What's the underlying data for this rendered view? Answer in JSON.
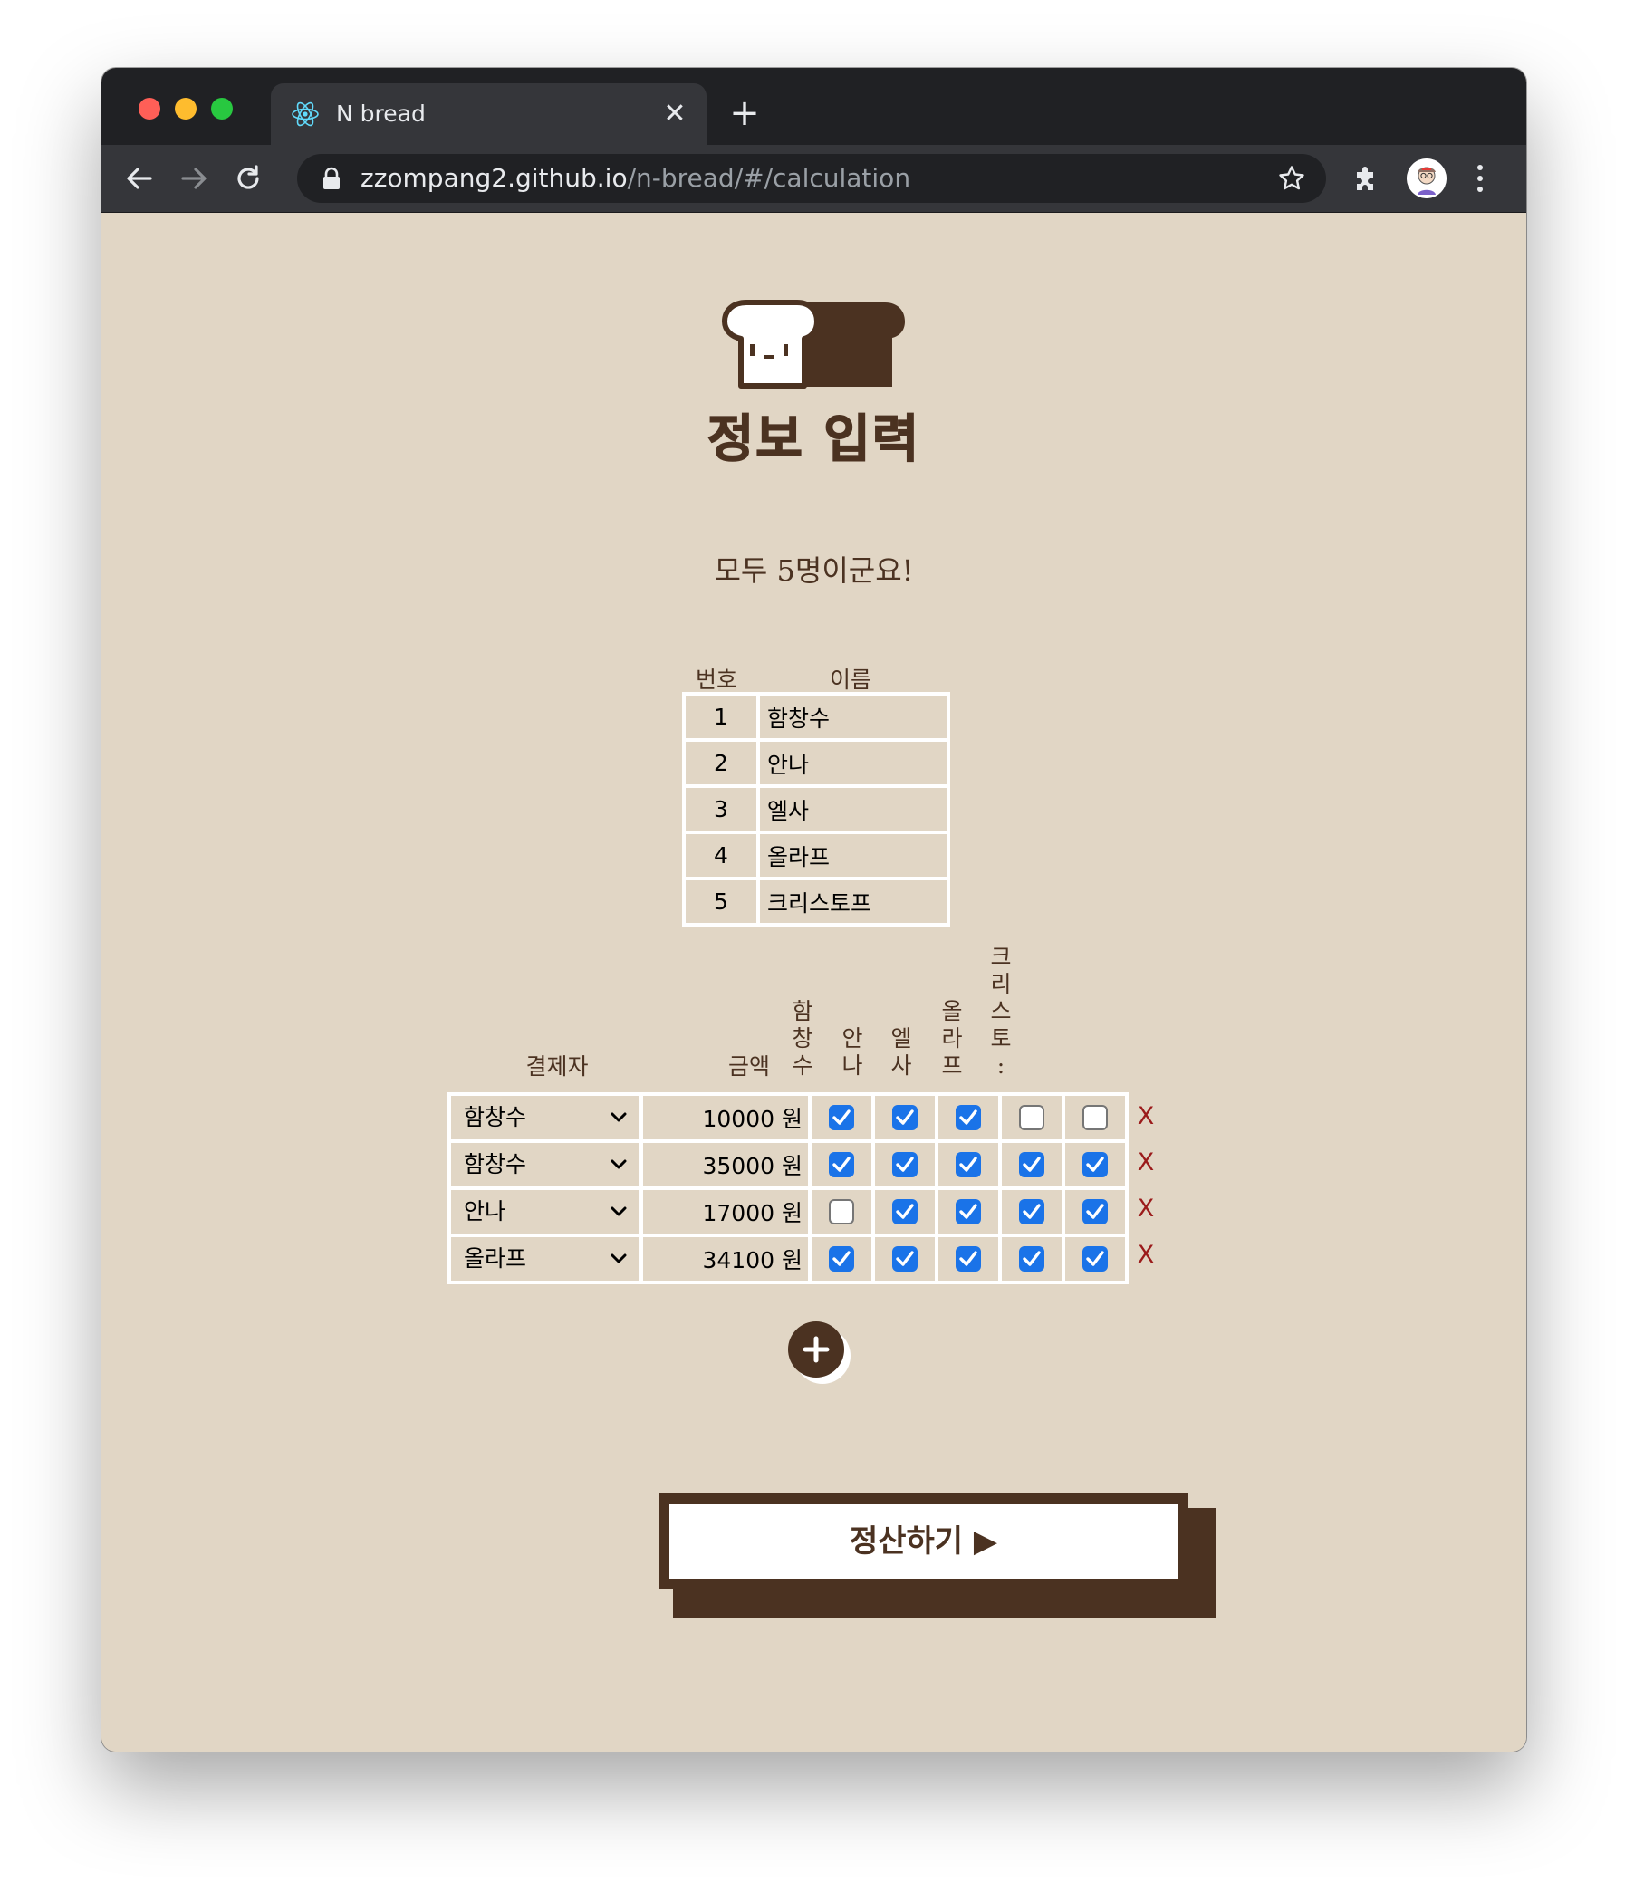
{
  "browser": {
    "tab_title": "N bread",
    "url_domain": "zzompang2.github.io",
    "url_path": "/n-bread/#/calculation"
  },
  "page": {
    "title": "정보 입력",
    "subtitle": "모두 5명이군요!",
    "members_table": {
      "headers": [
        "번호",
        "이름"
      ],
      "rows": [
        {
          "num": "1",
          "name": "함창수"
        },
        {
          "num": "2",
          "name": "안나"
        },
        {
          "num": "3",
          "name": "엘사"
        },
        {
          "num": "4",
          "name": "올라프"
        },
        {
          "num": "5",
          "name": "크리스토프"
        }
      ]
    },
    "payments_table": {
      "payer_header": "결제자",
      "amount_header": "금액",
      "participant_headers": [
        "함창수",
        "안나",
        "엘사",
        "올라프",
        "크리스토:"
      ],
      "currency": "원",
      "delete_label": "X",
      "rows": [
        {
          "payer": "함창수",
          "amount": "10000",
          "checks": [
            true,
            true,
            true,
            false,
            false
          ]
        },
        {
          "payer": "함창수",
          "amount": "35000",
          "checks": [
            true,
            true,
            true,
            true,
            true
          ]
        },
        {
          "payer": "안나",
          "amount": "17000",
          "checks": [
            false,
            true,
            true,
            true,
            true
          ]
        },
        {
          "payer": "올라프",
          "amount": "34100",
          "checks": [
            true,
            true,
            true,
            true,
            true
          ]
        }
      ]
    },
    "add_button_label": "+",
    "calculate_button_label": "정산하기 ▶"
  },
  "colors": {
    "background": "#e1d6c5",
    "brown": "#4b3221",
    "checkbox": "#1a73e8",
    "delete": "#9b1b1b"
  }
}
